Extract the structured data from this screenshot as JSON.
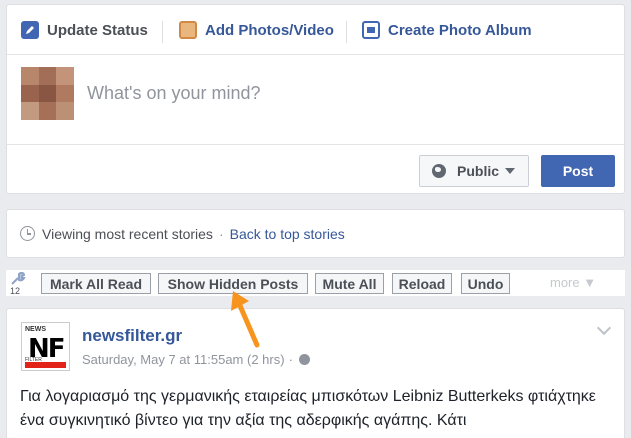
{
  "composer": {
    "tabs": [
      {
        "label": "Update Status",
        "icon": "pencil-icon"
      },
      {
        "label": "Add Photos/Video",
        "icon": "photo-icon"
      },
      {
        "label": "Create Photo Album",
        "icon": "album-icon"
      }
    ],
    "placeholder": "What's on your mind?",
    "audience_label": "Public",
    "post_label": "Post"
  },
  "viewing": {
    "text": "Viewing most recent stories",
    "separator": "·",
    "link": "Back to top stories"
  },
  "toolbar": {
    "count": "12",
    "buttons": [
      "Mark All Read",
      "Show Hidden Posts",
      "Mute All",
      "Reload",
      "Undo"
    ],
    "more_label": "more ▼"
  },
  "post": {
    "page_name": "newsfilter.gr",
    "timestamp": "Saturday, May 7 at 11:55am (2 hrs)",
    "separator": "·",
    "text": "Για λογαριασμό της γερμανικής εταιρείας μπισκότων Leibniz Butterkeks φτιάχτηκε ένα συγκινητικό βίντεο για την αξία της αδερφικής αγάπης. Κάτι",
    "logo": {
      "top": "NEWS",
      "big": "NF",
      "sub": "FILTER"
    }
  },
  "colors": {
    "facebook_blue": "#4267b2",
    "link_blue": "#365899",
    "background": "#e9ebee",
    "annotation_arrow": "#f7941d"
  }
}
